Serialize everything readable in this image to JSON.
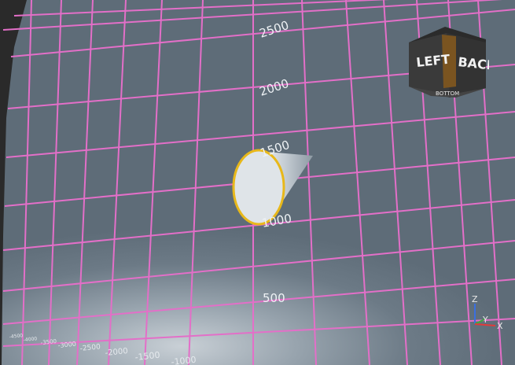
{
  "viewport": {
    "vertical_axis_labels": [
      "2500",
      "2000",
      "1500",
      "1000",
      "500"
    ],
    "bottom_axis_labels": [
      "-1500",
      "-1000",
      "-2000",
      "-2500",
      "-3000",
      "-3500",
      "-4000",
      "-4500"
    ]
  },
  "nav_cube": {
    "left_face": "LEFT",
    "back_face": "BACK",
    "bottom_face": "BOTTOM"
  },
  "axis_triad": {
    "z": "Z",
    "y": "Y",
    "x": "X"
  },
  "colors": {
    "grid": "#e36fc8",
    "selection_outline": "#e8b81a",
    "background": "#5e6c78"
  }
}
